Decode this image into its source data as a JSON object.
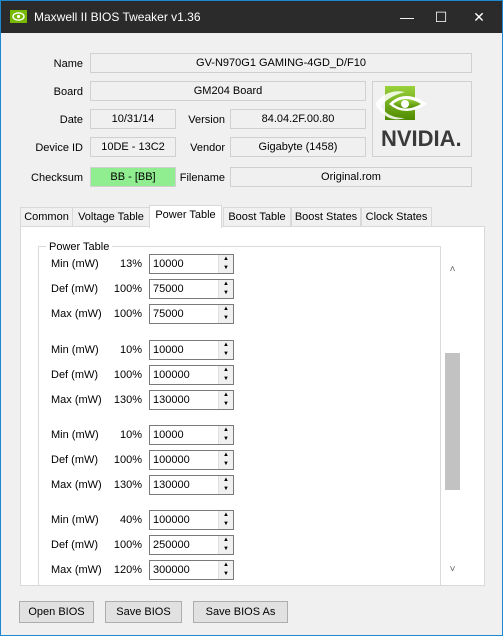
{
  "window": {
    "title": "Maxwell II BIOS Tweaker v1.36",
    "min_glyph": "—",
    "max_glyph": "☐",
    "close_glyph": "✕"
  },
  "info": {
    "name_label": "Name",
    "name_value": "GV-N970G1 GAMING-4GD_D/F10",
    "board_label": "Board",
    "board_value": "GM204 Board",
    "date_label": "Date",
    "date_value": "10/31/14",
    "version_label": "Version",
    "version_value": "84.04.2F.00.80",
    "device_id_label": "Device ID",
    "device_id_value": "10DE - 13C2",
    "vendor_label": "Vendor",
    "vendor_value": "Gigabyte (1458)",
    "checksum_label": "Checksum",
    "checksum_value": "BB - [BB]",
    "filename_label": "Filename",
    "filename_value": "Original.rom",
    "logo_text": "NVIDIA."
  },
  "tabs": [
    "Common",
    "Voltage Table",
    "Power Table",
    "Boost Table",
    "Boost States",
    "Clock States"
  ],
  "active_tab": "Power Table",
  "power_table": {
    "title": "Power Table",
    "rows": [
      {
        "label": "Min (mW)",
        "pct": "13%",
        "value": "10000"
      },
      {
        "label": "Def (mW)",
        "pct": "100%",
        "value": "75000"
      },
      {
        "label": "Max (mW)",
        "pct": "100%",
        "value": "75000"
      },
      {
        "label": "Min (mW)",
        "pct": "10%",
        "value": "10000"
      },
      {
        "label": "Def (mW)",
        "pct": "100%",
        "value": "100000"
      },
      {
        "label": "Max (mW)",
        "pct": "130%",
        "value": "130000"
      },
      {
        "label": "Min (mW)",
        "pct": "10%",
        "value": "10000"
      },
      {
        "label": "Def (mW)",
        "pct": "100%",
        "value": "100000"
      },
      {
        "label": "Max (mW)",
        "pct": "130%",
        "value": "130000"
      },
      {
        "label": "Min (mW)",
        "pct": "40%",
        "value": "100000"
      },
      {
        "label": "Def (mW)",
        "pct": "100%",
        "value": "250000"
      },
      {
        "label": "Max (mW)",
        "pct": "120%",
        "value": "300000"
      }
    ]
  },
  "scrollbar": {
    "up_glyph": "˄",
    "down_glyph": "˅"
  },
  "spin": {
    "up_glyph": "▲",
    "down_glyph": "▼"
  },
  "buttons": {
    "open": "Open BIOS",
    "save": "Save BIOS",
    "save_as": "Save BIOS As"
  },
  "colors": {
    "titlebar": "#2b2b2b",
    "checksum_ok": "#90ee90",
    "nvidia_green": "#76b900"
  }
}
